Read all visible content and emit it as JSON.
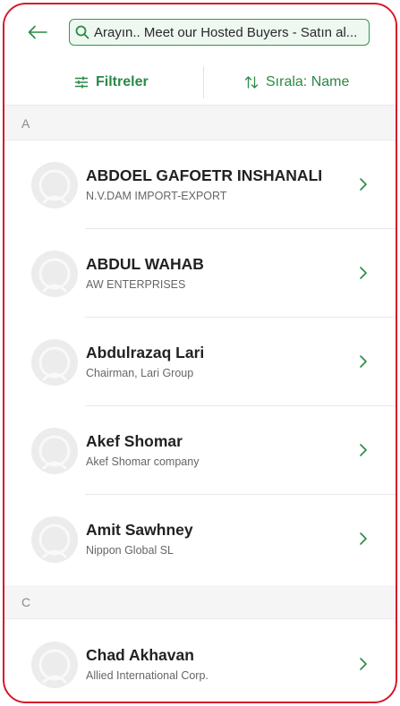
{
  "colors": {
    "accent": "#2a8a45",
    "frame": "#d6182a",
    "search_bg": "#eef7f0"
  },
  "search": {
    "placeholder": "Arayın.. Meet our Hosted Buyers - Satın al..."
  },
  "toolbar": {
    "filters_label": "Filtreler",
    "sort_label": "Sırala: Name"
  },
  "icons": [
    "back-arrow-icon",
    "search-icon",
    "filter-sliders-icon",
    "sort-arrows-icon",
    "avatar-placeholder-icon",
    "chevron-right-icon"
  ],
  "sections": [
    {
      "letter": "A",
      "contacts": [
        {
          "name": "ABDOEL GAFOETR INSHANALI",
          "company": "N.V.DAM IMPORT-EXPORT"
        },
        {
          "name": "ABDUL WAHAB",
          "company": "AW ENTERPRISES"
        },
        {
          "name": "Abdulrazaq Lari",
          "company": "Chairman, Lari Group"
        },
        {
          "name": "Akef Shomar",
          "company": "Akef Shomar company"
        },
        {
          "name": "Amit Sawhney",
          "company": "Nippon Global SL"
        }
      ]
    },
    {
      "letter": "C",
      "contacts": [
        {
          "name": "Chad Akhavan",
          "company": "Allied International Corp."
        }
      ]
    }
  ]
}
